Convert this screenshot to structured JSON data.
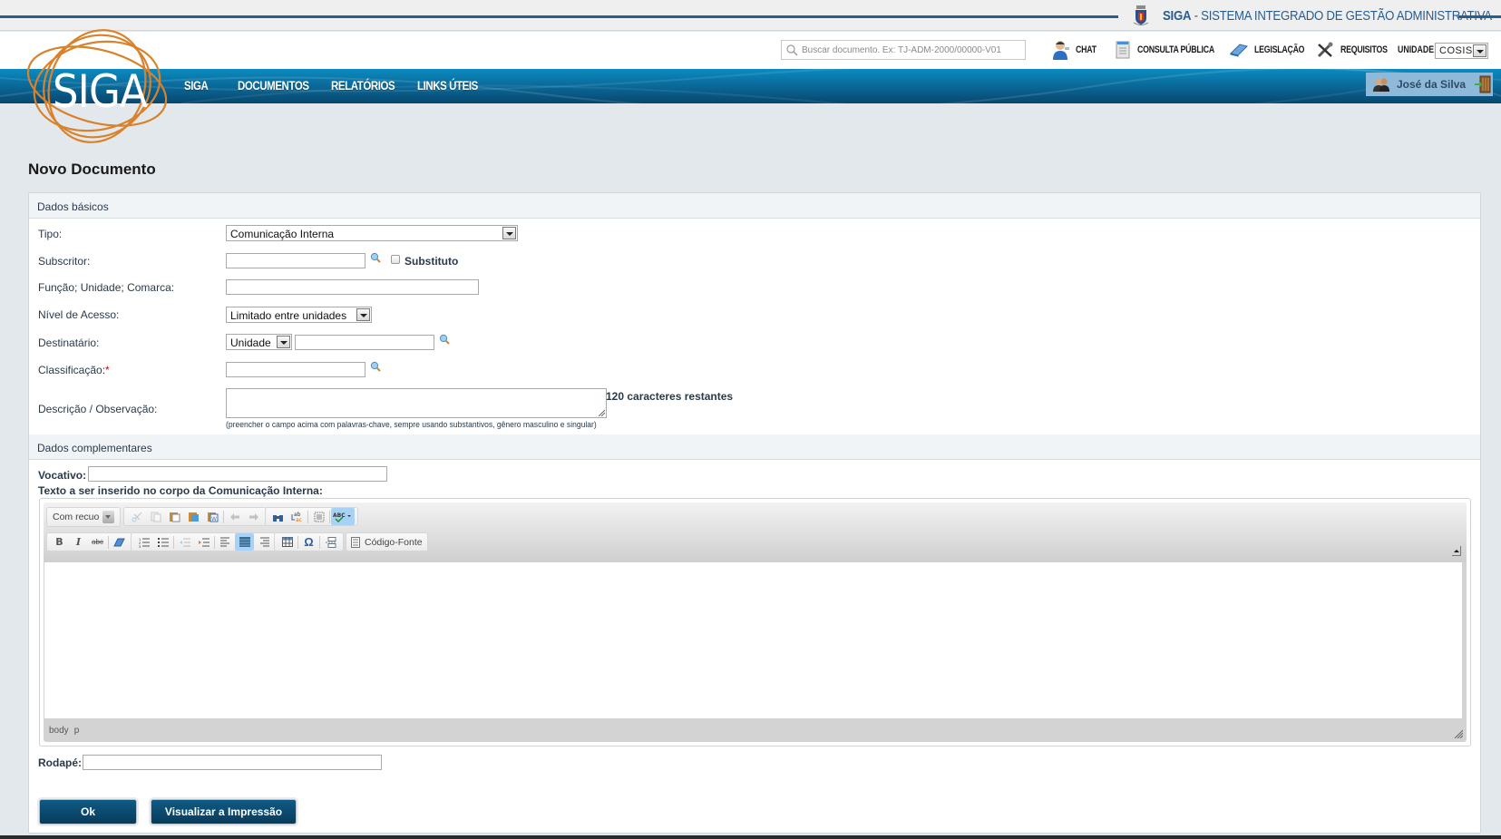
{
  "header": {
    "system_title_bold": "SIGA",
    "system_title_rest": " - SISTEMA INTEGRADO DE GESTÃO ADMINISTRATIVA",
    "logo_text": "SIGA",
    "search_placeholder": "Buscar documento. Ex: TJ-ADM-2000/00000-V01",
    "search_value": "",
    "top_links": [
      {
        "label": "CHAT",
        "icon": "chat-user-icon"
      },
      {
        "label": "CONSULTA PÚBLICA",
        "icon": "document-icon"
      },
      {
        "label": "LEGISLAÇÃO",
        "icon": "book-icon"
      },
      {
        "label": "REQUISITOS",
        "icon": "tools-icon"
      }
    ],
    "unidade_label": "UNIDADE:",
    "unidade_value": "COSIS",
    "nav": [
      {
        "label": "SIGA"
      },
      {
        "label": "DOCUMENTOS"
      },
      {
        "label": "RELATÓRIOS"
      },
      {
        "label": "LINKS ÚTEIS"
      }
    ],
    "user_name": "José da Silva"
  },
  "page": {
    "title": "Novo Documento"
  },
  "form": {
    "section_basic": "Dados básicos",
    "tipo_label": "Tipo:",
    "tipo_value": "Comunicação Interna",
    "subscritor_label": "Subscritor:",
    "subscritor_value": "",
    "substituto_label": "Substituto",
    "substituto_checked": false,
    "funcao_label": "Função; Unidade; Comarca:",
    "funcao_value": "",
    "nivel_label": "Nível de Acesso:",
    "nivel_value": "Limitado entre unidades",
    "destinatario_label": "Destinatário:",
    "destinatario_type": "Unidade",
    "destinatario_value": "",
    "classificacao_label": "Classificação:",
    "classificacao_required": "*",
    "classificacao_value": "",
    "descricao_label": "Descrição / Observação:",
    "descricao_value": "",
    "descricao_counter": "120 caracteres restantes",
    "descricao_hint": "(preencher o campo acima com palavras-chave, sempre usando substantivos, gênero masculino e singular)",
    "section_complementary": "Dados complementares",
    "vocativo_label": "Vocativo:",
    "vocativo_value": "",
    "texto_label": "Texto a ser inserido no corpo da Comunicação Interna:",
    "rodape_label": "Rodapé:",
    "rodape_value": ""
  },
  "editor": {
    "format_value": "Com recuo",
    "source_label": "Código-Fonte",
    "path": [
      "body",
      "p"
    ],
    "toolbar_row1": [
      "format-select",
      "cut",
      "copy",
      "paste",
      "paste-text",
      "paste-word",
      "undo",
      "redo",
      "find",
      "replace",
      "select-all",
      "spellcheck"
    ],
    "toolbar_row2": [
      "bold",
      "italic",
      "strike",
      "remove-format",
      "numbered-list",
      "bulleted-list",
      "outdent",
      "indent",
      "align-left",
      "align-justify",
      "align-right",
      "table",
      "special-char",
      "page-break",
      "source"
    ],
    "active_buttons": [
      "spellcheck",
      "align-justify"
    ]
  },
  "buttons": {
    "ok": "Ok",
    "preview": "Visualizar a Impressão"
  }
}
